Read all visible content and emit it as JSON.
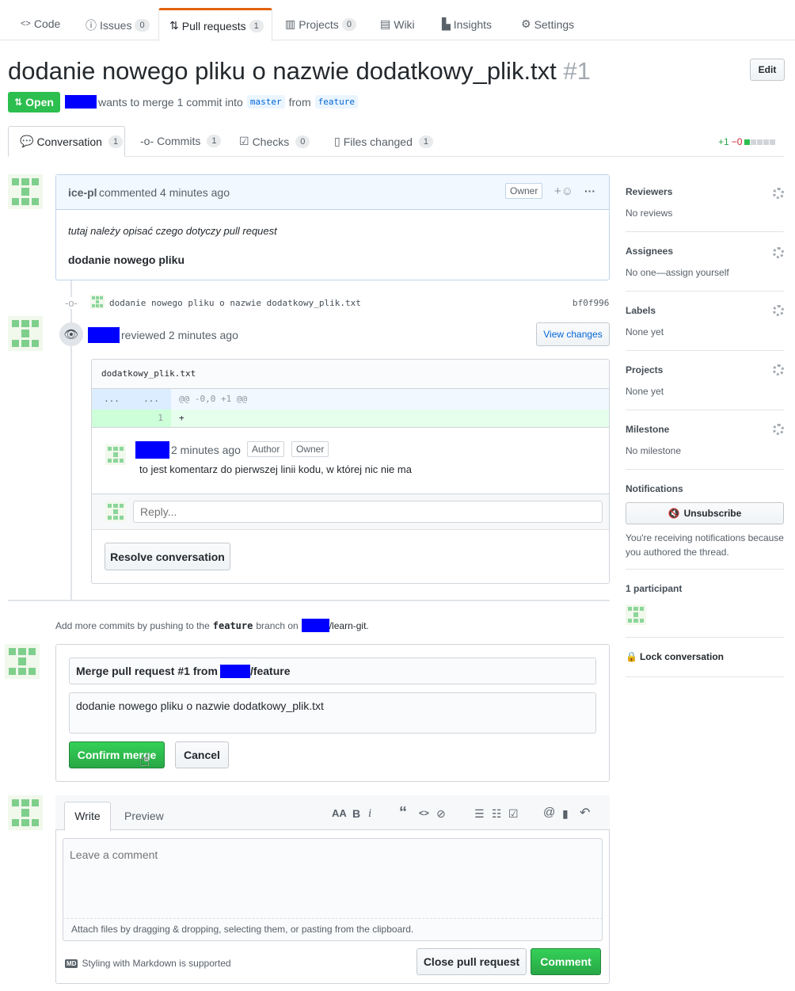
{
  "repo_nav": {
    "tabs": [
      {
        "label": "Code",
        "count": ""
      },
      {
        "label": "Issues",
        "count": "0"
      },
      {
        "label": "Pull requests",
        "count": "1"
      },
      {
        "label": "Projects",
        "count": "0"
      },
      {
        "label": "Wiki",
        "count": ""
      },
      {
        "label": "Insights",
        "count": ""
      },
      {
        "label": "Settings",
        "count": ""
      }
    ]
  },
  "pr": {
    "title": "dodanie nowego pliku o nazwie dodatkowy_plik.txt",
    "number": "#1",
    "edit_label": "Edit",
    "state_label": "Open",
    "merge_text": "wants to merge 1 commit into",
    "base_branch": "master",
    "from_text": "from",
    "head_branch": "feature"
  },
  "pr_tabs": [
    {
      "label": "Conversation",
      "count": "1"
    },
    {
      "label": "Commits",
      "count": "1"
    },
    {
      "label": "Checks",
      "count": "0"
    },
    {
      "label": "Files changed",
      "count": "1"
    }
  ],
  "diffstat": {
    "added": "+1",
    "removed": "−0"
  },
  "comment": {
    "author": "ice-pl",
    "action": "commented 4 minutes ago",
    "badge": "Owner",
    "reaction": "+☺",
    "more": "···",
    "body_italic": "tutaj należy opisać czego dotyczy pull request",
    "body_bold": "dodanie nowego pliku"
  },
  "commit": {
    "message": "dodanie nowego pliku o nazwie dodatkowy_plik.txt",
    "sha": "bf0f996"
  },
  "review": {
    "action": "reviewed 2 minutes ago",
    "view_changes": "View changes",
    "file_name": "dodatkowy_plik.txt",
    "hunk_left": "...",
    "hunk_right": "...",
    "hunk_header": "@@ -0,0 +1 @@",
    "line_number": "1",
    "line_content": "+",
    "comment_time": "2 minutes ago",
    "badge_author": "Author",
    "badge_owner": "Owner",
    "comment_body": "to jest komentarz do pierwszej linii kodu, w której nic nie ma",
    "reply_placeholder": "Reply...",
    "resolve_label": "Resolve conversation"
  },
  "push_hint": {
    "prefix": "Add more commits by pushing to the",
    "branch": "feature",
    "middle": "branch on",
    "repo": "/learn-git."
  },
  "merge_form": {
    "title_prefix": "Merge pull request #1 from",
    "title_suffix": "/feature",
    "message": "dodanie nowego pliku o nazwie dodatkowy_plik.txt",
    "confirm_label": "Confirm merge",
    "cancel_label": "Cancel"
  },
  "new_comment": {
    "tab_write": "Write",
    "tab_preview": "Preview",
    "placeholder": "Leave a comment",
    "attach_hint": "Attach files by dragging & dropping, selecting them, or pasting from the clipboard.",
    "markdown_badge": "MD",
    "markdown_hint": "Styling with Markdown is supported",
    "close_label": "Close pull request",
    "comment_label": "Comment",
    "toolbar": {
      "heading": "AA",
      "bold": "B",
      "italic": "i",
      "quote": "“",
      "code": "<>",
      "link": "⊘",
      "ul": "☰",
      "ol": "☷",
      "tasks": "☑",
      "mention": "@",
      "ref": "▮",
      "reply": "↶"
    }
  },
  "sidebar": {
    "reviewers": {
      "title": "Reviewers",
      "value": "No reviews"
    },
    "assignees": {
      "title": "Assignees",
      "value": "No one—assign yourself"
    },
    "labels": {
      "title": "Labels",
      "value": "None yet"
    },
    "projects": {
      "title": "Projects",
      "value": "None yet"
    },
    "milestone": {
      "title": "Milestone",
      "value": "No milestone"
    },
    "notifications": {
      "title": "Notifications",
      "button": "Unsubscribe",
      "note": "You're receiving notifications because you authored the thread."
    },
    "participants": {
      "title": "1 participant"
    },
    "lock": {
      "label": "Lock conversation"
    }
  }
}
